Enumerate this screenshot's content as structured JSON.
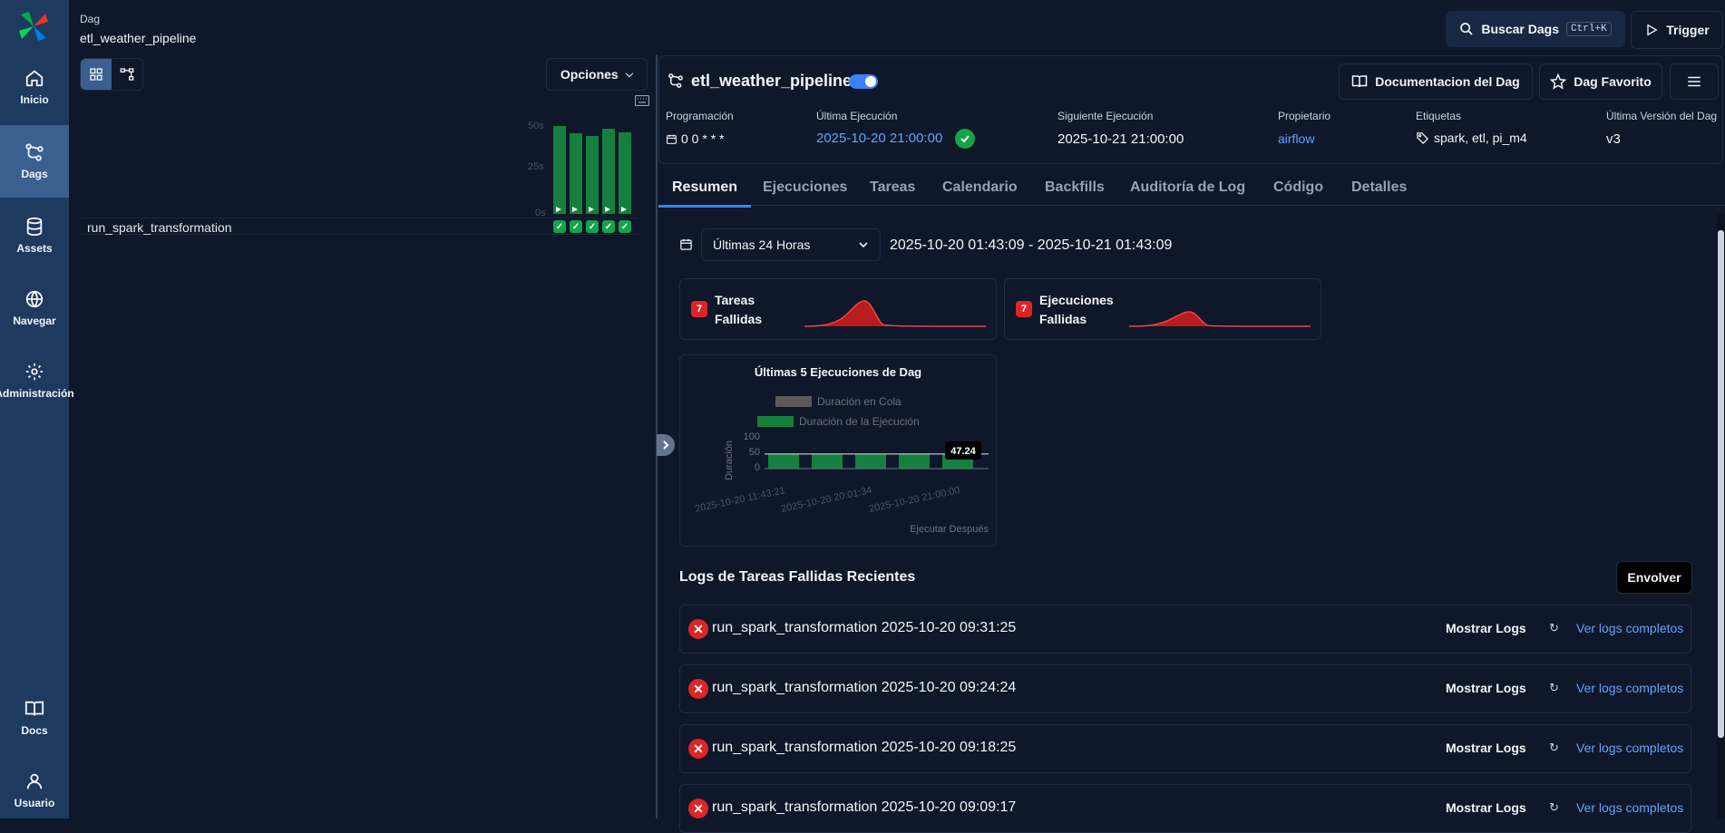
{
  "sidebar": {
    "items": [
      {
        "label": "Inicio",
        "icon": "home-icon"
      },
      {
        "label": "Dags",
        "icon": "dags-icon"
      },
      {
        "label": "Assets",
        "icon": "database-icon"
      },
      {
        "label": "Navegar",
        "icon": "globe-icon"
      },
      {
        "label": "Administración",
        "icon": "gear-icon"
      }
    ],
    "bottom": [
      {
        "label": "Docs",
        "icon": "book-icon"
      },
      {
        "label": "Usuario",
        "icon": "user-icon"
      }
    ]
  },
  "breadcrumb": {
    "section": "Dag",
    "name": "etl_weather_pipeline"
  },
  "header": {
    "search_label": "Buscar Dags",
    "search_shortcut": "Ctrl+K",
    "trigger_label": "Trigger"
  },
  "left_panel": {
    "options_label": "Opciones",
    "grid_axis": [
      "50s",
      "25s",
      "0s"
    ],
    "task_name": "run_spark_transformation",
    "run_bars": [
      0.97,
      0.89,
      0.86,
      0.94,
      0.9
    ],
    "status_color": "#16a34a"
  },
  "dag": {
    "name": "etl_weather_pipeline",
    "paused": false,
    "doc_button": "Documentacion del Dag",
    "fav_button": "Dag Favorito",
    "meta": {
      "schedule_label": "Programación",
      "schedule_value": "0 0 * * *",
      "last_run_label": "Última Ejecución",
      "last_run_value": "2025-10-20 21:00:00",
      "next_run_label": "Siguiente Ejecución",
      "next_run_value": "2025-10-21 21:00:00",
      "owner_label": "Propietario",
      "owner_value": "airflow",
      "tags_label": "Etiquetas",
      "tags_value": "spark, etl, pi_m4",
      "version_label": "Última Versión del Dag",
      "version_value": "v3"
    }
  },
  "tabs": [
    "Resumen",
    "Ejecuciones",
    "Tareas",
    "Calendario",
    "Backfills",
    "Auditoría de Log",
    "Código",
    "Detalles"
  ],
  "summary": {
    "range_select": "Últimas 24 Horas",
    "range_text": "2025-10-20 01:43:09 - 2025-10-21 01:43:09",
    "failed_tasks": {
      "count": "7",
      "label_line1": "Tareas",
      "label_line2": "Fallidas"
    },
    "failed_runs": {
      "count": "7",
      "label_line1": "Ejecuciones",
      "label_line2": "Fallidas"
    },
    "accent_red": "#dc2626"
  },
  "chart_data": {
    "type": "bar",
    "title": "Últimas 5 Ejecuciones de Dag",
    "legend": [
      "Duración en Cola",
      "Duración de la Ejecución"
    ],
    "legend_colors": [
      "#5a5a5a",
      "#15803d"
    ],
    "ylabel": "Duración",
    "xlabel": "Ejecutar Después",
    "yticks": [
      "100",
      "50",
      "0"
    ],
    "ylim": [
      0,
      100
    ],
    "categories": [
      "2025-10-20 11:43:21",
      "2025-10-20 20:01:34",
      "2025-10-20 21:00:00"
    ],
    "series": [
      {
        "name": "Duración de la Ejecución",
        "values": [
          47,
          46,
          46,
          47,
          47.24
        ]
      }
    ],
    "tooltip": "47.24"
  },
  "logs": {
    "title": "Logs de Tareas Fallidas Recientes",
    "wrap_button": "Envolver",
    "show_label": "Mostrar Logs",
    "full_label": "Ver logs completos",
    "rows": [
      "run_spark_transformation 2025-10-20 09:31:25",
      "run_spark_transformation 2025-10-20 09:24:24",
      "run_spark_transformation 2025-10-20 09:18:25",
      "run_spark_transformation 2025-10-20 09:09:17"
    ]
  }
}
